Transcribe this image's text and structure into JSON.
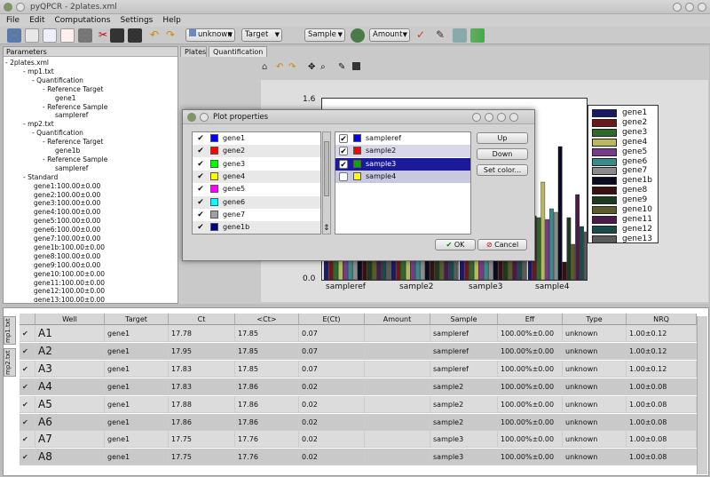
{
  "window": {
    "title": "pyQPCR - 2plates.xml"
  },
  "menu": [
    "File",
    "Edit",
    "Computations",
    "Settings",
    "Help"
  ],
  "toolbar": {
    "combo_unknown": "unknown",
    "combo_target": "Target",
    "combo_sample": "Sample",
    "combo_amount": "Amount"
  },
  "params": {
    "header": "Parameters",
    "tree": [
      "- 2plates.xml",
      "- mp1.txt",
      "- Quantification",
      "- Reference Target",
      "gene1",
      "- Reference Sample",
      "sampleref",
      "- mp2.txt",
      "- Quantification",
      "- Reference Target",
      "gene1b",
      "- Reference Sample",
      "sampleref",
      "- Standard",
      "gene1:100.00±0.00",
      "gene2:100.00±0.00",
      "gene3:100.00±0.00",
      "gene4:100.00±0.00",
      "gene5:100.00±0.00",
      "gene6:100.00±0.00",
      "gene7:100.00±0.00",
      "gene1b:100.00±0.00",
      "gene8:100.00±0.00",
      "gene9:100.00±0.00",
      "gene10:100.00±0.00",
      "gene11:100.00±0.00",
      "gene12:100.00±0.00",
      "gene13:100.00±0.00"
    ]
  },
  "tabs": {
    "plates": "Plates",
    "quant": "Quantification"
  },
  "chart_data": {
    "type": "bar",
    "categories": [
      "sampleref",
      "sample2",
      "sample3",
      "sample4"
    ],
    "yticks": [
      "0.0",
      "1.6"
    ],
    "series": [
      {
        "name": "gene1",
        "color": "#1a1a6b"
      },
      {
        "name": "gene2",
        "color": "#6b1a1a"
      },
      {
        "name": "gene3",
        "color": "#2d6b2d"
      },
      {
        "name": "gene4",
        "color": "#b8b860"
      },
      {
        "name": "gene5",
        "color": "#7a3a8a"
      },
      {
        "name": "gene6",
        "color": "#3a8a8a"
      },
      {
        "name": "gene7",
        "color": "#8a8a8a"
      },
      {
        "name": "gene1b",
        "color": "#0a0a22"
      },
      {
        "name": "gene8",
        "color": "#3a1010"
      },
      {
        "name": "gene9",
        "color": "#1e3a1e"
      },
      {
        "name": "gene10",
        "color": "#5a5a2a"
      },
      {
        "name": "gene11",
        "color": "#4a1a4a"
      },
      {
        "name": "gene12",
        "color": "#1a4a4a"
      },
      {
        "name": "gene13",
        "color": "#5a5a5a"
      }
    ]
  },
  "dialog": {
    "title": "Plot properties",
    "genes": [
      {
        "name": "gene1",
        "color": "#0000ff"
      },
      {
        "name": "gene2",
        "color": "#ff0000"
      },
      {
        "name": "gene3",
        "color": "#00ff00"
      },
      {
        "name": "gene4",
        "color": "#ffff00"
      },
      {
        "name": "gene5",
        "color": "#ff00ff"
      },
      {
        "name": "gene6",
        "color": "#00ffff"
      },
      {
        "name": "gene7",
        "color": "#a0a0a4"
      },
      {
        "name": "gene1b",
        "color": "#000080"
      }
    ],
    "samples": [
      {
        "name": "sampleref",
        "color": "#0000ff",
        "checked": true
      },
      {
        "name": "sample2",
        "color": "#ff0000",
        "checked": true
      },
      {
        "name": "sample3",
        "color": "#00aa00",
        "checked": true,
        "selected": true
      },
      {
        "name": "sample4",
        "color": "#ffff00",
        "checked": false
      }
    ],
    "up": "Up",
    "down": "Down",
    "setcolor": "Set color...",
    "ok": "OK",
    "cancel": "Cancel"
  },
  "grid": {
    "vtabs": [
      "mp1.txt",
      "mp2.txt"
    ],
    "headers": [
      "Well",
      "Target",
      "Ct",
      "<Ct>",
      "E(Ct)",
      "Amount",
      "Sample",
      "Eff",
      "Type",
      "NRQ"
    ],
    "rows": [
      [
        "A1",
        "gene1",
        "17.78",
        "17.85",
        "0.07",
        "",
        "sampleref",
        "100.00%±0.00",
        "unknown",
        "1.00±0.12"
      ],
      [
        "A2",
        "gene1",
        "17.95",
        "17.85",
        "0.07",
        "",
        "sampleref",
        "100.00%±0.00",
        "unknown",
        "1.00±0.12"
      ],
      [
        "A3",
        "gene1",
        "17.83",
        "17.85",
        "0.07",
        "",
        "sampleref",
        "100.00%±0.00",
        "unknown",
        "1.00±0.12"
      ],
      [
        "A4",
        "gene1",
        "17.83",
        "17.86",
        "0.02",
        "",
        "sample2",
        "100.00%±0.00",
        "unknown",
        "1.00±0.08"
      ],
      [
        "A5",
        "gene1",
        "17.88",
        "17.86",
        "0.02",
        "",
        "sample2",
        "100.00%±0.00",
        "unknown",
        "1.00±0.08"
      ],
      [
        "A6",
        "gene1",
        "17.86",
        "17.86",
        "0.02",
        "",
        "sample2",
        "100.00%±0.00",
        "unknown",
        "1.00±0.08"
      ],
      [
        "A7",
        "gene1",
        "17.75",
        "17.76",
        "0.02",
        "",
        "sample3",
        "100.00%±0.00",
        "unknown",
        "1.00±0.08"
      ],
      [
        "A8",
        "gene1",
        "17.75",
        "17.76",
        "0.02",
        "",
        "sample3",
        "100.00%±0.00",
        "unknown",
        "1.00±0.08"
      ]
    ]
  }
}
